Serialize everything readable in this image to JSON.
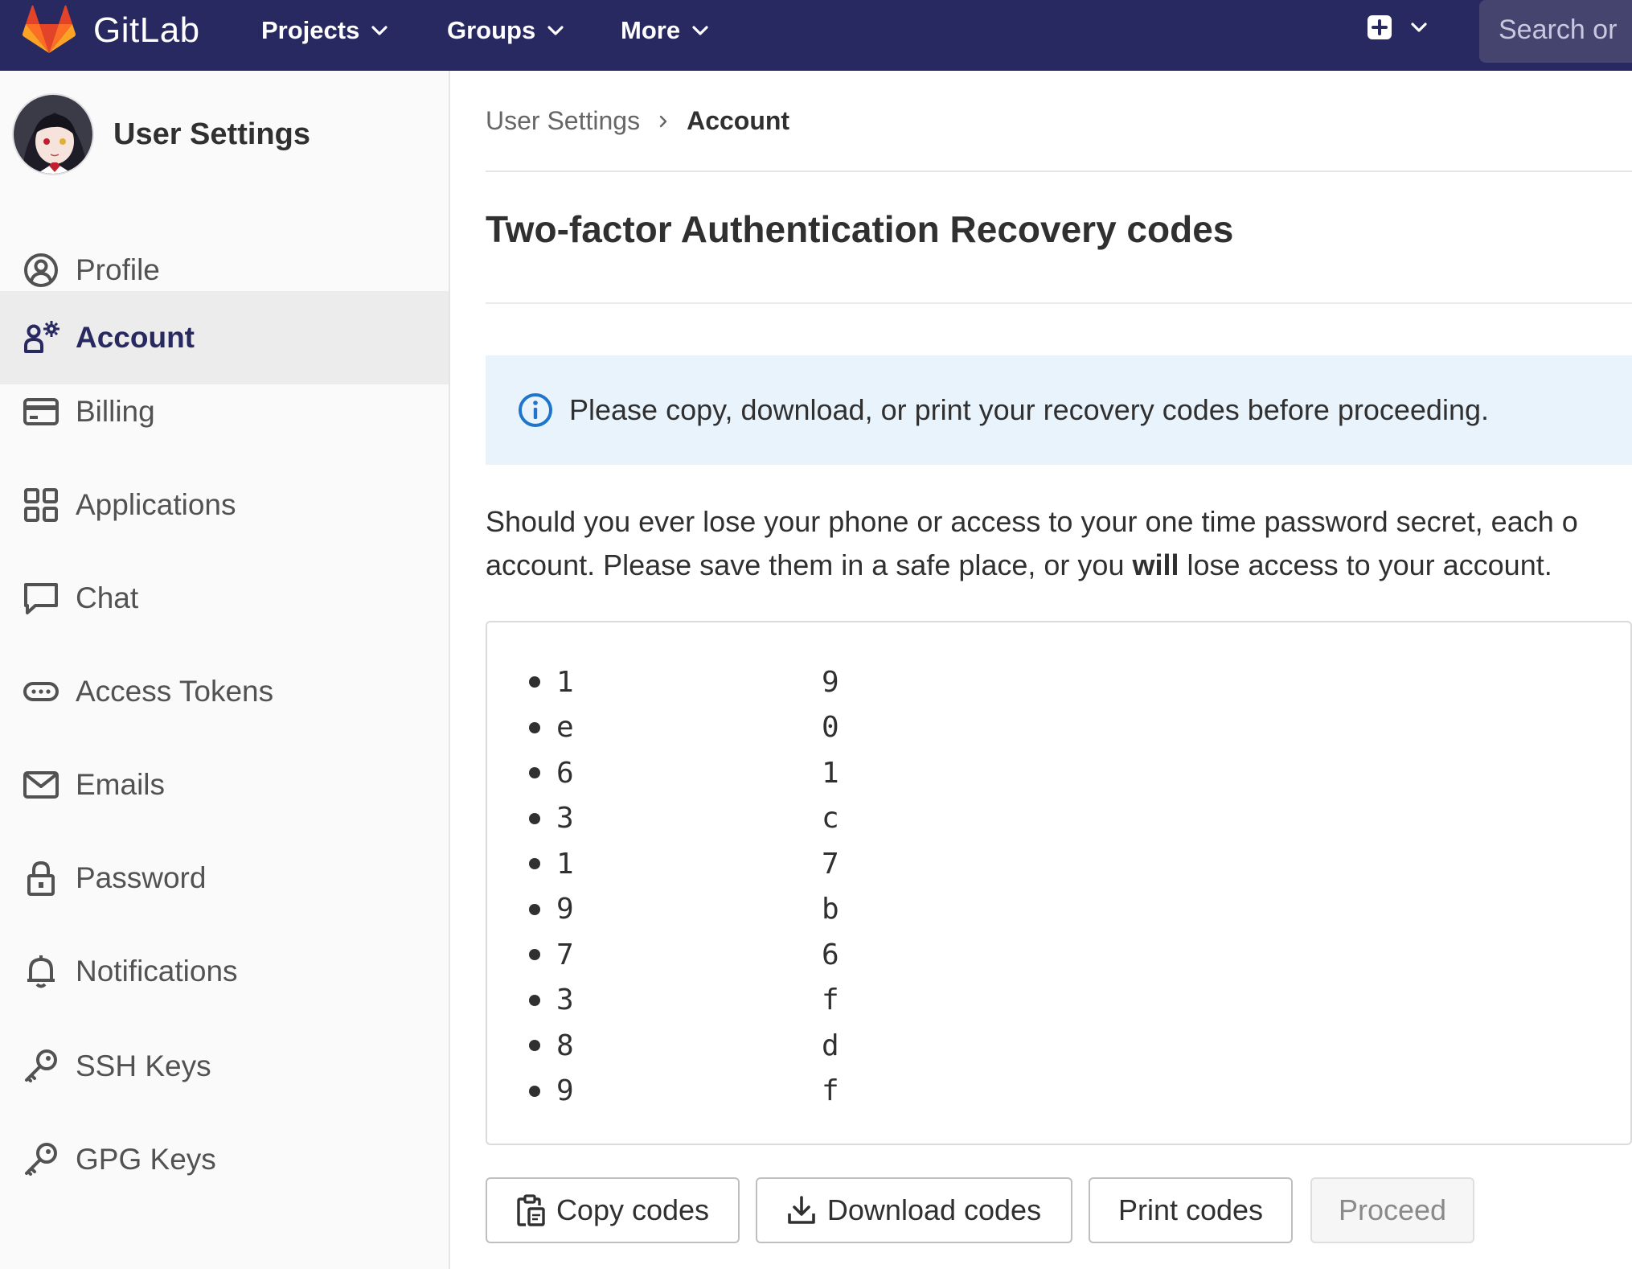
{
  "navbar": {
    "brand": "GitLab",
    "projects_label": "Projects",
    "groups_label": "Groups",
    "more_label": "More",
    "search_placeholder": "Search or"
  },
  "sidebar": {
    "title": "User Settings",
    "items": [
      {
        "label": "Profile",
        "icon": "profile-icon",
        "active": false
      },
      {
        "label": "Account",
        "icon": "account-icon",
        "active": true
      },
      {
        "label": "Billing",
        "icon": "credit-card-icon",
        "active": false
      },
      {
        "label": "Applications",
        "icon": "applications-icon",
        "active": false
      },
      {
        "label": "Chat",
        "icon": "chat-icon",
        "active": false
      },
      {
        "label": "Access Tokens",
        "icon": "token-icon",
        "active": false
      },
      {
        "label": "Emails",
        "icon": "mail-icon",
        "active": false
      },
      {
        "label": "Password",
        "icon": "lock-icon",
        "active": false
      },
      {
        "label": "Notifications",
        "icon": "bell-icon",
        "active": false
      },
      {
        "label": "SSH Keys",
        "icon": "key-icon",
        "active": false
      },
      {
        "label": "GPG Keys",
        "icon": "key-icon",
        "active": false
      }
    ]
  },
  "breadcrumb": {
    "parent": "User Settings",
    "current": "Account"
  },
  "page": {
    "title": "Two-factor Authentication Recovery codes",
    "alert": "Please copy, download, or print your recovery codes before proceeding.",
    "description_line1": "Should you ever lose your phone or access to your one time password secret, each o",
    "description_line2_pre": "account. Please save them in a safe place, or you ",
    "description_line2_bold": "will",
    "description_line2_post": " lose access to your account."
  },
  "recovery_codes": [
    {
      "first": "1",
      "last": "9"
    },
    {
      "first": "e",
      "last": "0"
    },
    {
      "first": "6",
      "last": "1"
    },
    {
      "first": "3",
      "last": "c"
    },
    {
      "first": "1",
      "last": "7"
    },
    {
      "first": "9",
      "last": "b"
    },
    {
      "first": "7",
      "last": "6"
    },
    {
      "first": "3",
      "last": "f"
    },
    {
      "first": "8",
      "last": "d"
    },
    {
      "first": "9",
      "last": "f"
    }
  ],
  "buttons": {
    "copy": "Copy codes",
    "download": "Download codes",
    "print": "Print codes",
    "proceed": "Proceed"
  },
  "colors": {
    "navbar_bg": "#292961",
    "active_text": "#292961",
    "alert_bg": "#e9f3fc",
    "info_icon": "#1f75cb"
  }
}
